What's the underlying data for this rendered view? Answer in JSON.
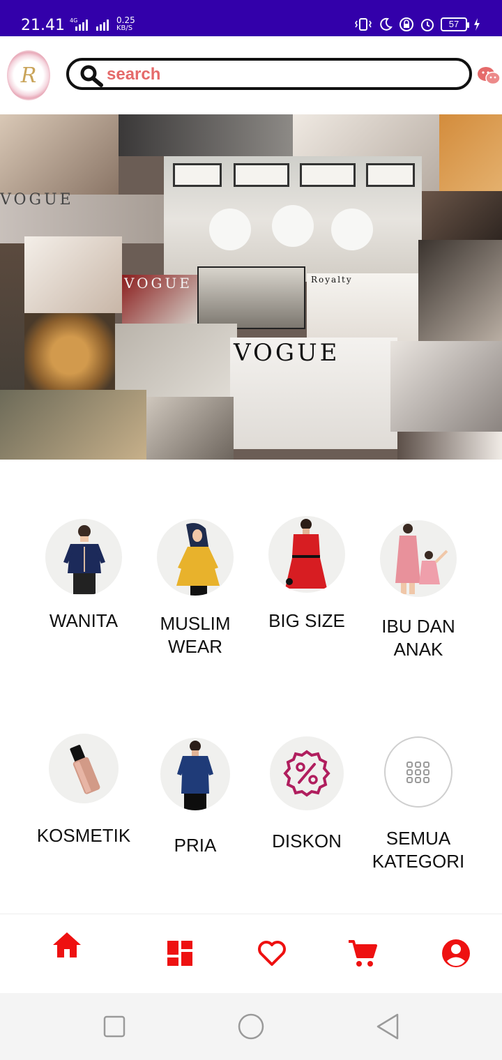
{
  "status_bar": {
    "time": "21.41",
    "network": "4G",
    "speed_value": "0.25",
    "speed_unit": "KB/S",
    "battery": "57"
  },
  "header": {
    "logo_letter": "R",
    "search_placeholder": "search",
    "icons": [
      "search-icon",
      "chat-icon"
    ]
  },
  "banner": {
    "texts": [
      "VOGUE",
      "VOGUE",
      "VOGUE",
      "Royalty"
    ]
  },
  "categories": [
    {
      "label": "WANITA",
      "icon": "blouse-model"
    },
    {
      "label": "MUSLIM\nWEAR",
      "icon": "hijab-model"
    },
    {
      "label": "BIG SIZE",
      "icon": "dress-model"
    },
    {
      "label": "IBU DAN\nANAK",
      "icon": "mother-child"
    },
    {
      "label": "KOSMETIK",
      "icon": "cosmetic-bottle"
    },
    {
      "label": "PRIA",
      "icon": "man-shirt"
    },
    {
      "label": "DISKON",
      "icon": "percent-badge"
    },
    {
      "label": "SEMUA\nKATEGORI",
      "icon": "grid-dots"
    }
  ],
  "bottom_nav": [
    {
      "name": "home",
      "icon": "home-icon"
    },
    {
      "name": "dashboard",
      "icon": "dashboard-icon"
    },
    {
      "name": "wishlist",
      "icon": "heart-icon"
    },
    {
      "name": "cart",
      "icon": "cart-icon"
    },
    {
      "name": "account",
      "icon": "account-icon"
    }
  ],
  "colors": {
    "status_bar": "#3300aa",
    "accent": "#ee1111",
    "search_text": "#e56a6a",
    "diskon": "#b01e5e"
  }
}
